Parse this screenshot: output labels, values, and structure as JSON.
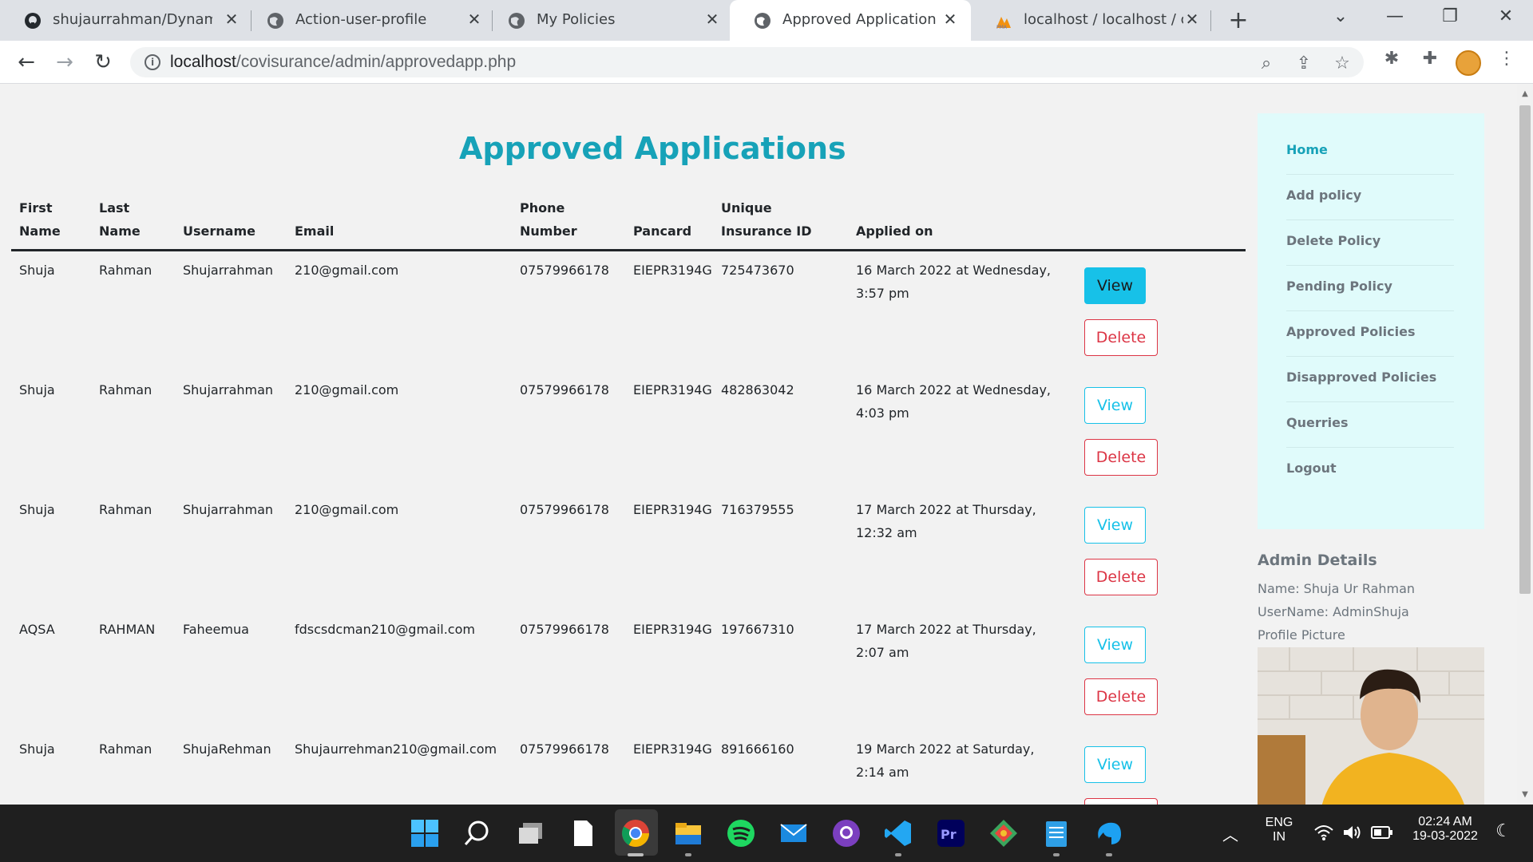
{
  "browser": {
    "tabs": [
      {
        "label": "shujaurrahman/Dynamic-I",
        "icon": "github-icon"
      },
      {
        "label": "Action-user-profile",
        "icon": "globe-icon"
      },
      {
        "label": "My Policies",
        "icon": "globe-icon"
      },
      {
        "label": "Approved Application",
        "icon": "globe-icon"
      },
      {
        "label": "localhost / localhost / cov",
        "icon": "phpmyadmin-icon"
      }
    ],
    "url_host": "localhost",
    "url_path": "/covisurance/admin/approvedapp.php"
  },
  "page": {
    "title": "Approved Applications",
    "columns": [
      {
        "line1": "First",
        "line2": "Name"
      },
      {
        "line1": "Last",
        "line2": "Name"
      },
      {
        "line1": "",
        "line2": "Username"
      },
      {
        "line1": "",
        "line2": "Email"
      },
      {
        "line1": "Phone",
        "line2": "Number"
      },
      {
        "line1": "",
        "line2": "Pancard"
      },
      {
        "line1": "Unique",
        "line2": "Insurance ID"
      },
      {
        "line1": "",
        "line2": "Applied on"
      }
    ],
    "rows": [
      {
        "first": "Shuja",
        "last": "Rahman",
        "username": "Shujarrahman",
        "email": "210@gmail.com",
        "phone": "07579966178",
        "pancard": "EIEPR3194G",
        "insurance_id": "725473670",
        "applied_1": "16 March 2022 at Wednesday,",
        "applied_2": "3:57 pm"
      },
      {
        "first": "Shuja",
        "last": "Rahman",
        "username": "Shujarrahman",
        "email": "210@gmail.com",
        "phone": "07579966178",
        "pancard": "EIEPR3194G",
        "insurance_id": "482863042",
        "applied_1": "16 March 2022 at Wednesday,",
        "applied_2": "4:03 pm"
      },
      {
        "first": "Shuja",
        "last": "Rahman",
        "username": "Shujarrahman",
        "email": "210@gmail.com",
        "phone": "07579966178",
        "pancard": "EIEPR3194G",
        "insurance_id": "716379555",
        "applied_1": "17 March 2022 at Thursday,",
        "applied_2": "12:32 am"
      },
      {
        "first": "AQSA",
        "last": "RAHMAN",
        "username": "Faheemua",
        "email": "fdscsdcman210@gmail.com",
        "phone": "07579966178",
        "pancard": "EIEPR3194G",
        "insurance_id": "197667310",
        "applied_1": "17 March 2022 at Thursday,",
        "applied_2": "2:07 am"
      },
      {
        "first": "Shuja",
        "last": "Rahman",
        "username": "ShujaRehman",
        "email": "Shujaurrehman210@gmail.com",
        "phone": "07579966178",
        "pancard": "EIEPR3194G",
        "insurance_id": "891666160",
        "applied_1": "19 March 2022 at Saturday,",
        "applied_2": "2:14 am"
      }
    ],
    "view_label": "View",
    "delete_label": "Delete"
  },
  "sidebar": {
    "items": [
      "Home",
      "Add policy",
      "Delete Policy",
      "Pending Policy",
      "Approved Policies",
      "Disapproved Policies",
      "Querries",
      "Logout"
    ]
  },
  "admin": {
    "title": "Admin Details",
    "name": "Name: Shuja Ur Rahman",
    "username": "UserName: AdminShuja",
    "picture_label": "Profile Picture"
  },
  "taskbar": {
    "lang1": "ENG",
    "lang2": "IN",
    "time": "02:24 AM",
    "date": "19-03-2022"
  },
  "colors": {
    "accent": "#17a2b8",
    "view": "#17c1e8",
    "delete": "#dc3545",
    "sidebar_bg": "#e0fbfb"
  }
}
